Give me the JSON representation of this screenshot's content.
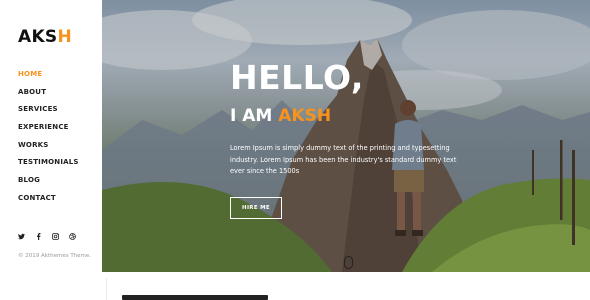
{
  "brand": {
    "logo_prefix": "AKS",
    "logo_accent": "H",
    "accent_color": "#f7921e"
  },
  "nav": {
    "items": [
      {
        "label": "HOME",
        "active": true
      },
      {
        "label": "ABOUT"
      },
      {
        "label": "SERVICES"
      },
      {
        "label": "EXPERIENCE"
      },
      {
        "label": "WORKS"
      },
      {
        "label": "TESTIMONIALS"
      },
      {
        "label": "BLOG"
      },
      {
        "label": "CONTACT"
      }
    ]
  },
  "social": [
    "twitter-icon",
    "facebook-icon",
    "instagram-icon",
    "dribbble-icon"
  ],
  "footer": {
    "copyright": "© 2019 Akthemes Theme."
  },
  "hero": {
    "greeting": "HELLO,",
    "intro_prefix": "I AM ",
    "intro_name": "AKSH",
    "description": "Lorem Ipsum is simply dummy text of the printing and typesetting industry. Lorem Ipsum has been the industry's standard dummy text ever since the 1500s",
    "button_label": "HIRE ME"
  }
}
